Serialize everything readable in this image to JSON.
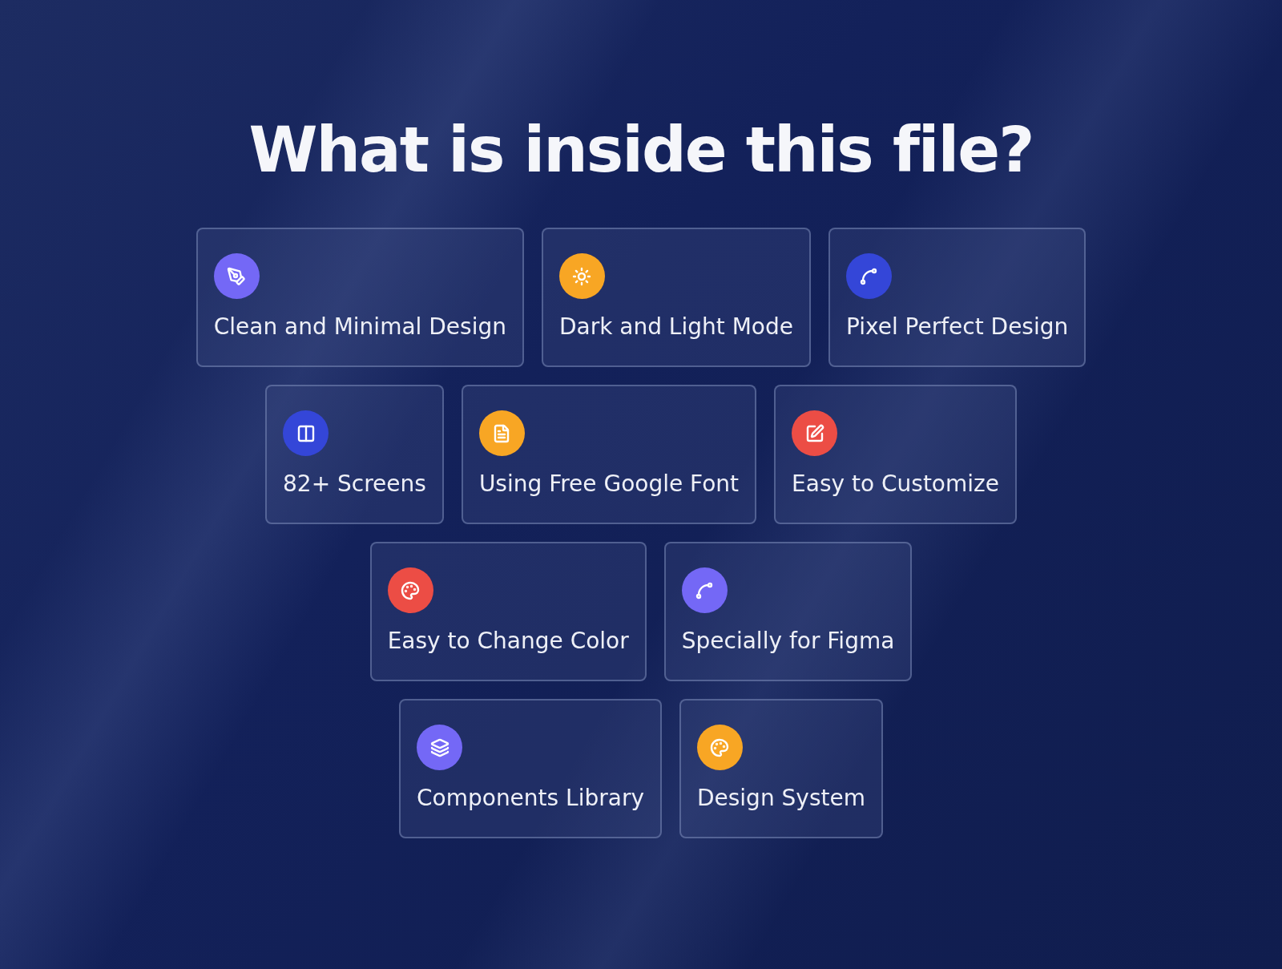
{
  "title": "What is inside this file?",
  "rows": [
    [
      {
        "label": "Clean and Minimal Design",
        "kind": "pen",
        "color": "#7468f6"
      },
      {
        "label": "Dark and Light Mode",
        "kind": "sun",
        "color": "#f8a624"
      },
      {
        "label": "Pixel Perfect Design",
        "kind": "bezier",
        "color": "#3446d8"
      }
    ],
    [
      {
        "label": "82+ Screens",
        "kind": "screens",
        "color": "#3446d8"
      },
      {
        "label": "Using Free Google Font",
        "kind": "file",
        "color": "#f8a624"
      },
      {
        "label": "Easy to Customize",
        "kind": "edit",
        "color": "#ec4d45"
      }
    ],
    [
      {
        "label": "Easy to Change Color",
        "kind": "palette",
        "color": "#ec4d45"
      },
      {
        "label": "Specially for Figma",
        "kind": "bezier",
        "color": "#7468f6"
      }
    ],
    [
      {
        "label": "Components Library",
        "kind": "layers",
        "color": "#7468f6"
      },
      {
        "label": "Design System",
        "kind": "palette",
        "color": "#f8a624"
      }
    ]
  ]
}
